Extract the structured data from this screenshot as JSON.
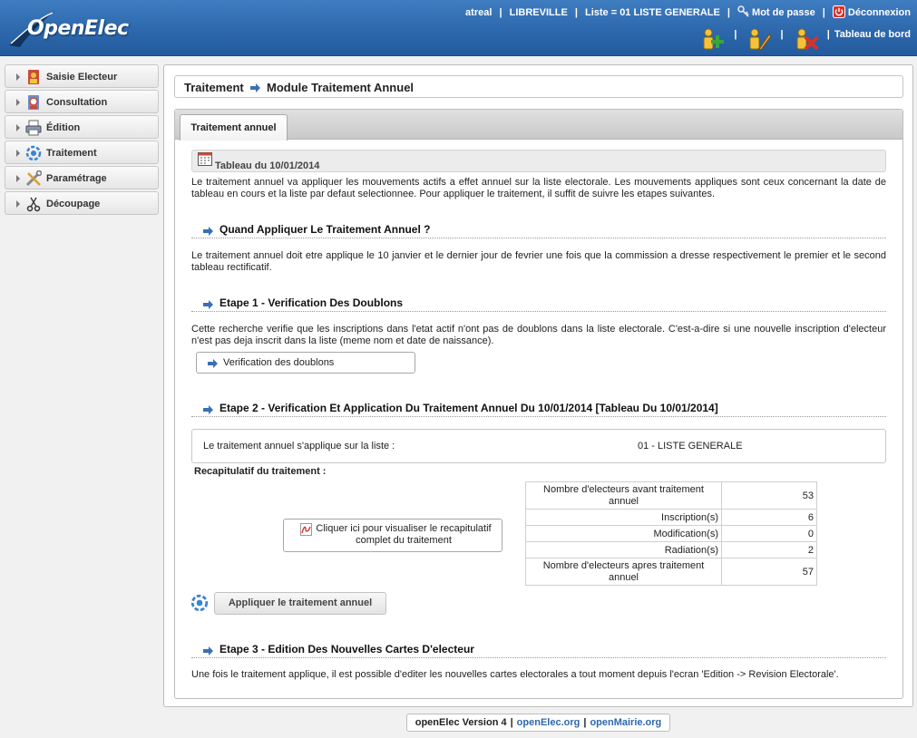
{
  "header": {
    "logo_text": "OpenElec",
    "user": "atreal",
    "city": "LIBREVILLE",
    "list": "Liste = 01 LISTE GENERALE",
    "password_link": "Mot de passe",
    "logout_link": "Déconnexion",
    "dashboard_link": "Tableau de bord",
    "separator": "|"
  },
  "sidebar": {
    "items": [
      {
        "label": "Saisie Electeur",
        "icon": "user-edit-icon"
      },
      {
        "label": "Consultation",
        "icon": "folder-search-icon"
      },
      {
        "label": "Édition",
        "icon": "printer-icon"
      },
      {
        "label": "Traitement",
        "icon": "gear-refresh-icon"
      },
      {
        "label": "Paramétrage",
        "icon": "tools-icon"
      },
      {
        "label": "Découpage",
        "icon": "scissors-icon"
      }
    ]
  },
  "breadcrumb": {
    "root": "Traitement",
    "current": "Module Traitement Annuel"
  },
  "tabs": [
    {
      "label": "Traitement annuel",
      "active": true
    }
  ],
  "main": {
    "tableau_title": "Tableau du 10/01/2014",
    "intro": "Le traitement annuel va appliquer les mouvements actifs a effet annuel sur la liste electorale. Les mouvements appliques sont ceux concernant la date de tableau en cours et la liste par defaut selectionnee. Pour appliquer le traitement, il suffit de suivre les etapes suivantes.",
    "q_title": "Quand Appliquer Le Traitement Annuel ?",
    "q_text": "Le traitement annuel doit etre applique le 10 janvier et le dernier jour de fevrier une fois que la commission a dresse respectivement le premier et le second tableau rectificatif.",
    "step1_title": "Etape 1 - Verification Des Doublons",
    "step1_text": "Cette recherche verifie que les inscriptions dans l'etat actif n'ont pas de doublons dans la liste electorale. C'est-a-dire si une nouvelle inscription d'electeur n'est pas deja inscrit dans la liste (meme nom et date de naissance).",
    "step1_button": "Verification des doublons",
    "step2_title": "Etape 2 - Verification Et Application Du Traitement Annuel Du 10/01/2014 [Tableau Du 10/01/2014]",
    "list_label": "Le traitement annuel s'applique sur la liste :",
    "list_value": "01 - LISTE GENERALE",
    "recap_title": "Recapitulatif du traitement :",
    "recap_button": "Cliquer ici pour visualiser le recapitulatif complet du traitement",
    "recap_rows": [
      {
        "label": "Nombre d'electeurs avant traitement annuel",
        "value": "53"
      },
      {
        "label": "Inscription(s)",
        "value": "6"
      },
      {
        "label": "Modification(s)",
        "value": "0"
      },
      {
        "label": "Radiation(s)",
        "value": "2"
      },
      {
        "label": "Nombre d'electeurs apres traitement annuel",
        "value": "57"
      }
    ],
    "apply_button": "Appliquer le traitement annuel",
    "step3_title": "Etape 3 - Edition Des Nouvelles Cartes D'electeur",
    "step3_text": "Une fois le traitement applique, il est possible d'editer les nouvelles cartes electorales a tout moment depuis l'ecran 'Edition -> Revision Electorale'."
  },
  "footer": {
    "version": "openElec Version 4",
    "link1": "openElec.org",
    "link2": "openMairie.org",
    "separator": "|"
  },
  "colors": {
    "header_blue": "#2d68ad",
    "link_blue": "#2d68ad",
    "arrow_blue": "#3a6fb5"
  }
}
